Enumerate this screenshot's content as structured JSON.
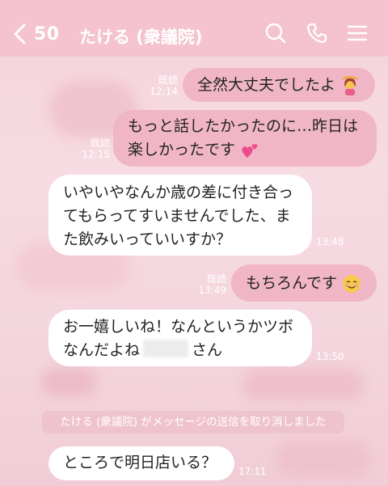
{
  "header": {
    "back_count": "50",
    "title": "たける (衆議院)",
    "icons": [
      "chevron-left-icon",
      "search-icon",
      "phone-icon",
      "menu-icon"
    ],
    "bg_color": "#f4c3cf"
  },
  "messages": [
    {
      "side": "out",
      "text": "全然大丈夫でしたよ",
      "emoji": "woman-gesturing-ok",
      "read": "既読",
      "time": "12:14"
    },
    {
      "side": "out",
      "lines": [
        "もっと話したかったのに…昨日は",
        "楽しかったです"
      ],
      "emoji": "two-hearts",
      "read": "既読",
      "time": "12:15"
    },
    {
      "side": "in",
      "lines": [
        "いやいやなんか歳の差に付き合っ",
        "てもらってすいませんでした、ま",
        "た飲みいっていいすか？"
      ],
      "time": "13:48"
    },
    {
      "side": "out",
      "text": "もちろんです",
      "emoji": "smiling-face",
      "read": "既読",
      "time": "13:49"
    },
    {
      "side": "in",
      "lines": [
        "お一嬉しいね！なんというかツボ",
        "なんだよね"
      ],
      "line2_suffix": "さん",
      "redacted": true,
      "time": "13:50"
    },
    {
      "side": "in",
      "text": "ところで明日店いる？",
      "time": "17:11"
    }
  ],
  "notice": "たける (衆議院) がメッセージの送信を取り消しました",
  "colors": {
    "outgoing_bubble": "#f1b6c5",
    "incoming_bubble": "#ffffff",
    "meta_text": "#ffffff"
  }
}
